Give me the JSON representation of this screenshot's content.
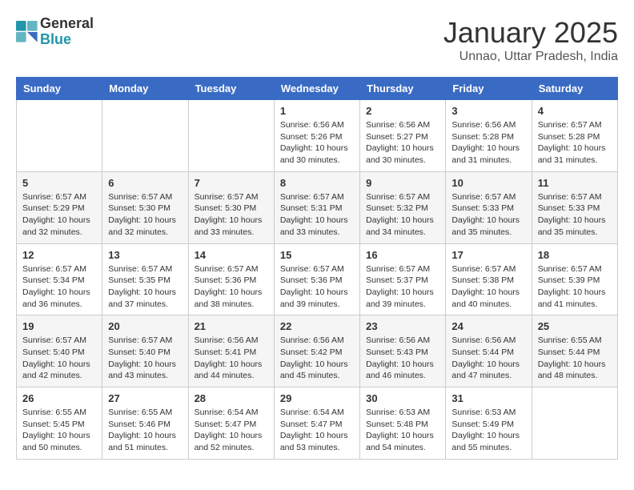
{
  "header": {
    "logo_line1": "General",
    "logo_line2": "Blue",
    "month_title": "January 2025",
    "location": "Unnao, Uttar Pradesh, India"
  },
  "weekdays": [
    "Sunday",
    "Monday",
    "Tuesday",
    "Wednesday",
    "Thursday",
    "Friday",
    "Saturday"
  ],
  "weeks": [
    [
      {
        "day": "",
        "info": ""
      },
      {
        "day": "",
        "info": ""
      },
      {
        "day": "",
        "info": ""
      },
      {
        "day": "1",
        "info": "Sunrise: 6:56 AM\nSunset: 5:26 PM\nDaylight: 10 hours\nand 30 minutes."
      },
      {
        "day": "2",
        "info": "Sunrise: 6:56 AM\nSunset: 5:27 PM\nDaylight: 10 hours\nand 30 minutes."
      },
      {
        "day": "3",
        "info": "Sunrise: 6:56 AM\nSunset: 5:28 PM\nDaylight: 10 hours\nand 31 minutes."
      },
      {
        "day": "4",
        "info": "Sunrise: 6:57 AM\nSunset: 5:28 PM\nDaylight: 10 hours\nand 31 minutes."
      }
    ],
    [
      {
        "day": "5",
        "info": "Sunrise: 6:57 AM\nSunset: 5:29 PM\nDaylight: 10 hours\nand 32 minutes."
      },
      {
        "day": "6",
        "info": "Sunrise: 6:57 AM\nSunset: 5:30 PM\nDaylight: 10 hours\nand 32 minutes."
      },
      {
        "day": "7",
        "info": "Sunrise: 6:57 AM\nSunset: 5:30 PM\nDaylight: 10 hours\nand 33 minutes."
      },
      {
        "day": "8",
        "info": "Sunrise: 6:57 AM\nSunset: 5:31 PM\nDaylight: 10 hours\nand 33 minutes."
      },
      {
        "day": "9",
        "info": "Sunrise: 6:57 AM\nSunset: 5:32 PM\nDaylight: 10 hours\nand 34 minutes."
      },
      {
        "day": "10",
        "info": "Sunrise: 6:57 AM\nSunset: 5:33 PM\nDaylight: 10 hours\nand 35 minutes."
      },
      {
        "day": "11",
        "info": "Sunrise: 6:57 AM\nSunset: 5:33 PM\nDaylight: 10 hours\nand 35 minutes."
      }
    ],
    [
      {
        "day": "12",
        "info": "Sunrise: 6:57 AM\nSunset: 5:34 PM\nDaylight: 10 hours\nand 36 minutes."
      },
      {
        "day": "13",
        "info": "Sunrise: 6:57 AM\nSunset: 5:35 PM\nDaylight: 10 hours\nand 37 minutes."
      },
      {
        "day": "14",
        "info": "Sunrise: 6:57 AM\nSunset: 5:36 PM\nDaylight: 10 hours\nand 38 minutes."
      },
      {
        "day": "15",
        "info": "Sunrise: 6:57 AM\nSunset: 5:36 PM\nDaylight: 10 hours\nand 39 minutes."
      },
      {
        "day": "16",
        "info": "Sunrise: 6:57 AM\nSunset: 5:37 PM\nDaylight: 10 hours\nand 39 minutes."
      },
      {
        "day": "17",
        "info": "Sunrise: 6:57 AM\nSunset: 5:38 PM\nDaylight: 10 hours\nand 40 minutes."
      },
      {
        "day": "18",
        "info": "Sunrise: 6:57 AM\nSunset: 5:39 PM\nDaylight: 10 hours\nand 41 minutes."
      }
    ],
    [
      {
        "day": "19",
        "info": "Sunrise: 6:57 AM\nSunset: 5:40 PM\nDaylight: 10 hours\nand 42 minutes."
      },
      {
        "day": "20",
        "info": "Sunrise: 6:57 AM\nSunset: 5:40 PM\nDaylight: 10 hours\nand 43 minutes."
      },
      {
        "day": "21",
        "info": "Sunrise: 6:56 AM\nSunset: 5:41 PM\nDaylight: 10 hours\nand 44 minutes."
      },
      {
        "day": "22",
        "info": "Sunrise: 6:56 AM\nSunset: 5:42 PM\nDaylight: 10 hours\nand 45 minutes."
      },
      {
        "day": "23",
        "info": "Sunrise: 6:56 AM\nSunset: 5:43 PM\nDaylight: 10 hours\nand 46 minutes."
      },
      {
        "day": "24",
        "info": "Sunrise: 6:56 AM\nSunset: 5:44 PM\nDaylight: 10 hours\nand 47 minutes."
      },
      {
        "day": "25",
        "info": "Sunrise: 6:55 AM\nSunset: 5:44 PM\nDaylight: 10 hours\nand 48 minutes."
      }
    ],
    [
      {
        "day": "26",
        "info": "Sunrise: 6:55 AM\nSunset: 5:45 PM\nDaylight: 10 hours\nand 50 minutes."
      },
      {
        "day": "27",
        "info": "Sunrise: 6:55 AM\nSunset: 5:46 PM\nDaylight: 10 hours\nand 51 minutes."
      },
      {
        "day": "28",
        "info": "Sunrise: 6:54 AM\nSunset: 5:47 PM\nDaylight: 10 hours\nand 52 minutes."
      },
      {
        "day": "29",
        "info": "Sunrise: 6:54 AM\nSunset: 5:47 PM\nDaylight: 10 hours\nand 53 minutes."
      },
      {
        "day": "30",
        "info": "Sunrise: 6:53 AM\nSunset: 5:48 PM\nDaylight: 10 hours\nand 54 minutes."
      },
      {
        "day": "31",
        "info": "Sunrise: 6:53 AM\nSunset: 5:49 PM\nDaylight: 10 hours\nand 55 minutes."
      },
      {
        "day": "",
        "info": ""
      }
    ]
  ]
}
